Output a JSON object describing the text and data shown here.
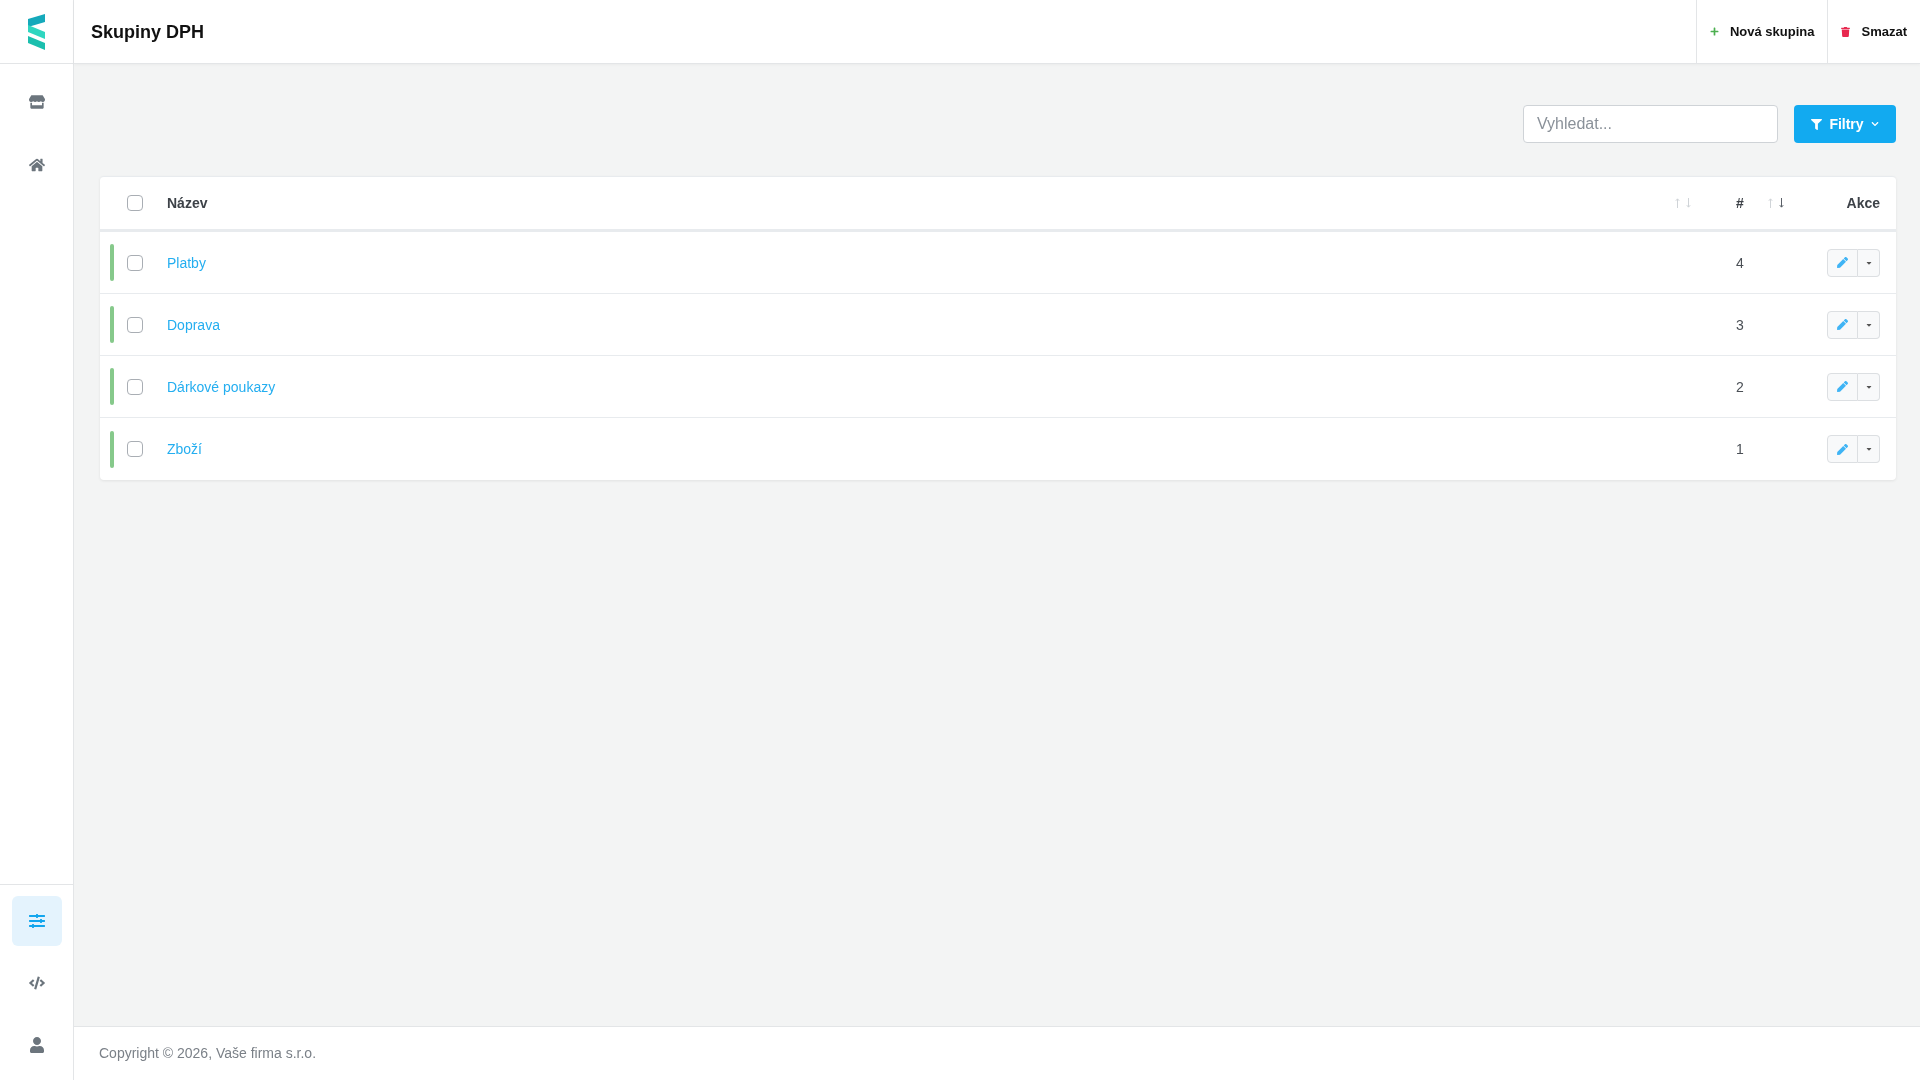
{
  "header": {
    "title": "Skupiny DPH",
    "actions": [
      {
        "kind": "add",
        "label": "Nová skupina"
      },
      {
        "kind": "delete",
        "label": "Smazat"
      }
    ]
  },
  "sidebar": {
    "top_items": [
      {
        "selected": false
      },
      {
        "selected": false
      }
    ],
    "bottom_items": [
      {
        "selected": true
      },
      {
        "selected": false
      },
      {
        "selected": false
      }
    ]
  },
  "toolbar": {
    "search": {
      "placeholder": "Vyhledat..."
    },
    "filter_button": "Filtry"
  },
  "table": {
    "header_checkbox": {
      "checked": false
    },
    "columns": [
      {
        "label": "Název",
        "sort_up_active": false,
        "sort_down_active": false
      },
      {
        "label": "#",
        "sort_up_active": false,
        "sort_down_active": true
      },
      {
        "label": "Akce"
      }
    ],
    "rows": [
      {
        "name": "Platby",
        "count": "4",
        "checked": false,
        "color": "#86c98b"
      },
      {
        "name": "Doprava",
        "count": "3",
        "checked": false,
        "color": "#86c98b"
      },
      {
        "name": "Dárkové poukazy",
        "count": "2",
        "checked": false,
        "color": "#86c98b"
      },
      {
        "name": "Zboží",
        "count": "1",
        "checked": false,
        "color": "#86c98b"
      }
    ]
  },
  "footer": {
    "text": "Copyright © 2026, Vaše firma s.r.o."
  }
}
